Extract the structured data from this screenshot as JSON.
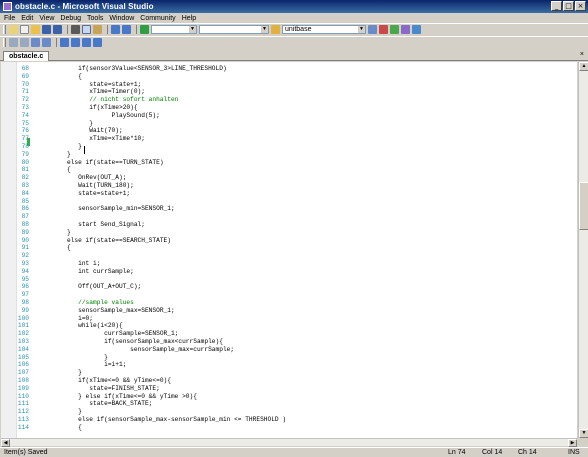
{
  "window": {
    "title": "obstacle.c - Microsoft Visual Studio"
  },
  "menu": [
    "File",
    "Edit",
    "View",
    "Debug",
    "Tools",
    "Window",
    "Community",
    "Help"
  ],
  "toolbar": {
    "solution_platform_combo": "unitbase"
  },
  "tabs": [
    {
      "label": "obstacle.c"
    }
  ],
  "code": [
    {
      "n": "68",
      "t": "          if(sensor3Value<SENSOR_3>LINE_THRESHOLD)"
    },
    {
      "n": "69",
      "t": "          {"
    },
    {
      "n": "70",
      "t": "             state=state+1;"
    },
    {
      "n": "71",
      "t": "             xTime=Timer(0);"
    },
    {
      "n": "72",
      "t": "             // nicht sofort anhalten",
      "c": true
    },
    {
      "n": "73",
      "t": "             if(xTime>20){"
    },
    {
      "n": "74",
      "t": "                   PlaySound(5);"
    },
    {
      "n": "75",
      "t": "             }"
    },
    {
      "n": "76",
      "t": "             Wait(70);"
    },
    {
      "n": "77",
      "t": "             xTime=xTime*10;"
    },
    {
      "n": "78",
      "t": "          }"
    },
    {
      "n": "79",
      "t": "       }"
    },
    {
      "n": "80",
      "t": "       else if(state==TURN_STATE)"
    },
    {
      "n": "81",
      "t": "       {"
    },
    {
      "n": "82",
      "t": "          OnRev(OUT_A);"
    },
    {
      "n": "83",
      "t": "          Wait(TURN_180);"
    },
    {
      "n": "84",
      "t": "          state=state+1;"
    },
    {
      "n": "85",
      "t": ""
    },
    {
      "n": "86",
      "t": "          sensorSample_min=SENSOR_1;"
    },
    {
      "n": "87",
      "t": ""
    },
    {
      "n": "88",
      "t": "          start Send_Signal;"
    },
    {
      "n": "89",
      "t": "       }"
    },
    {
      "n": "90",
      "t": "       else if(state==SEARCH_STATE)"
    },
    {
      "n": "91",
      "t": "       {"
    },
    {
      "n": "92",
      "t": ""
    },
    {
      "n": "93",
      "t": "          int i;"
    },
    {
      "n": "94",
      "t": "          int currSample;"
    },
    {
      "n": "95",
      "t": ""
    },
    {
      "n": "96",
      "t": "          Off(OUT_A+OUT_C);"
    },
    {
      "n": "97",
      "t": ""
    },
    {
      "n": "98",
      "t": "          //sample values",
      "c": true
    },
    {
      "n": "99",
      "t": "          sensorSample_max=SENSOR_1;"
    },
    {
      "n": "100",
      "t": "          i=0;"
    },
    {
      "n": "101",
      "t": "          while(i<20){"
    },
    {
      "n": "102",
      "t": "                 currSample=SENSOR_1;"
    },
    {
      "n": "103",
      "t": "                 if(sensorSample_max<currSample){"
    },
    {
      "n": "104",
      "t": "                        sensorSample_max=currSample;"
    },
    {
      "n": "105",
      "t": "                 }"
    },
    {
      "n": "106",
      "t": "                 i=i+1;"
    },
    {
      "n": "107",
      "t": "          }"
    },
    {
      "n": "108",
      "t": "          if(xTime<=0 && yTime<=0){"
    },
    {
      "n": "109",
      "t": "             state=FINISH_STATE;"
    },
    {
      "n": "110",
      "t": "          } else if(xTime<=0 && yTime >0){"
    },
    {
      "n": "111",
      "t": "             state=BACK_STATE;"
    },
    {
      "n": "112",
      "t": "          }"
    },
    {
      "n": "113",
      "t": "          else if(sensorSample_max-sensorSample_min <= THRESHOLD )"
    },
    {
      "n": "114",
      "t": "          {"
    }
  ],
  "status": {
    "message": "Item(s) Saved",
    "line": "Ln 74",
    "col": "Col 14",
    "ch": "Ch 14",
    "mode": "INS"
  },
  "colors": {
    "title_bar": "#0a246a",
    "line_numbers": "#2b91af",
    "comment": "#008000"
  }
}
